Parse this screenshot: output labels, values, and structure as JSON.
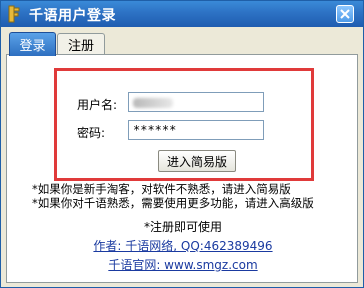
{
  "window": {
    "title": "千语用户登录",
    "accent": "#2d72c4",
    "highlight_color": "#e03a3a"
  },
  "tabs": [
    {
      "label": "登录",
      "active": true
    },
    {
      "label": "注册",
      "active": false
    }
  ],
  "login": {
    "username_label": "用户名:",
    "username_value": "",
    "password_label": "密码:",
    "password_value": "******",
    "simple_button": "进入简易版"
  },
  "tips": {
    "line1": "*如果你是新手淘客，对软件不熟悉，请进入简易版",
    "line2": "*如果你对千语熟悉，需要使用更多功能，请进入高级版"
  },
  "footer": {
    "register_note": "*注册即可使用",
    "author_link": "作者: 千语网络, QQ:462389496",
    "site_link": "千语官网: www.smgz.com"
  },
  "icons": {
    "app": "key-icon",
    "close": "close-icon"
  }
}
